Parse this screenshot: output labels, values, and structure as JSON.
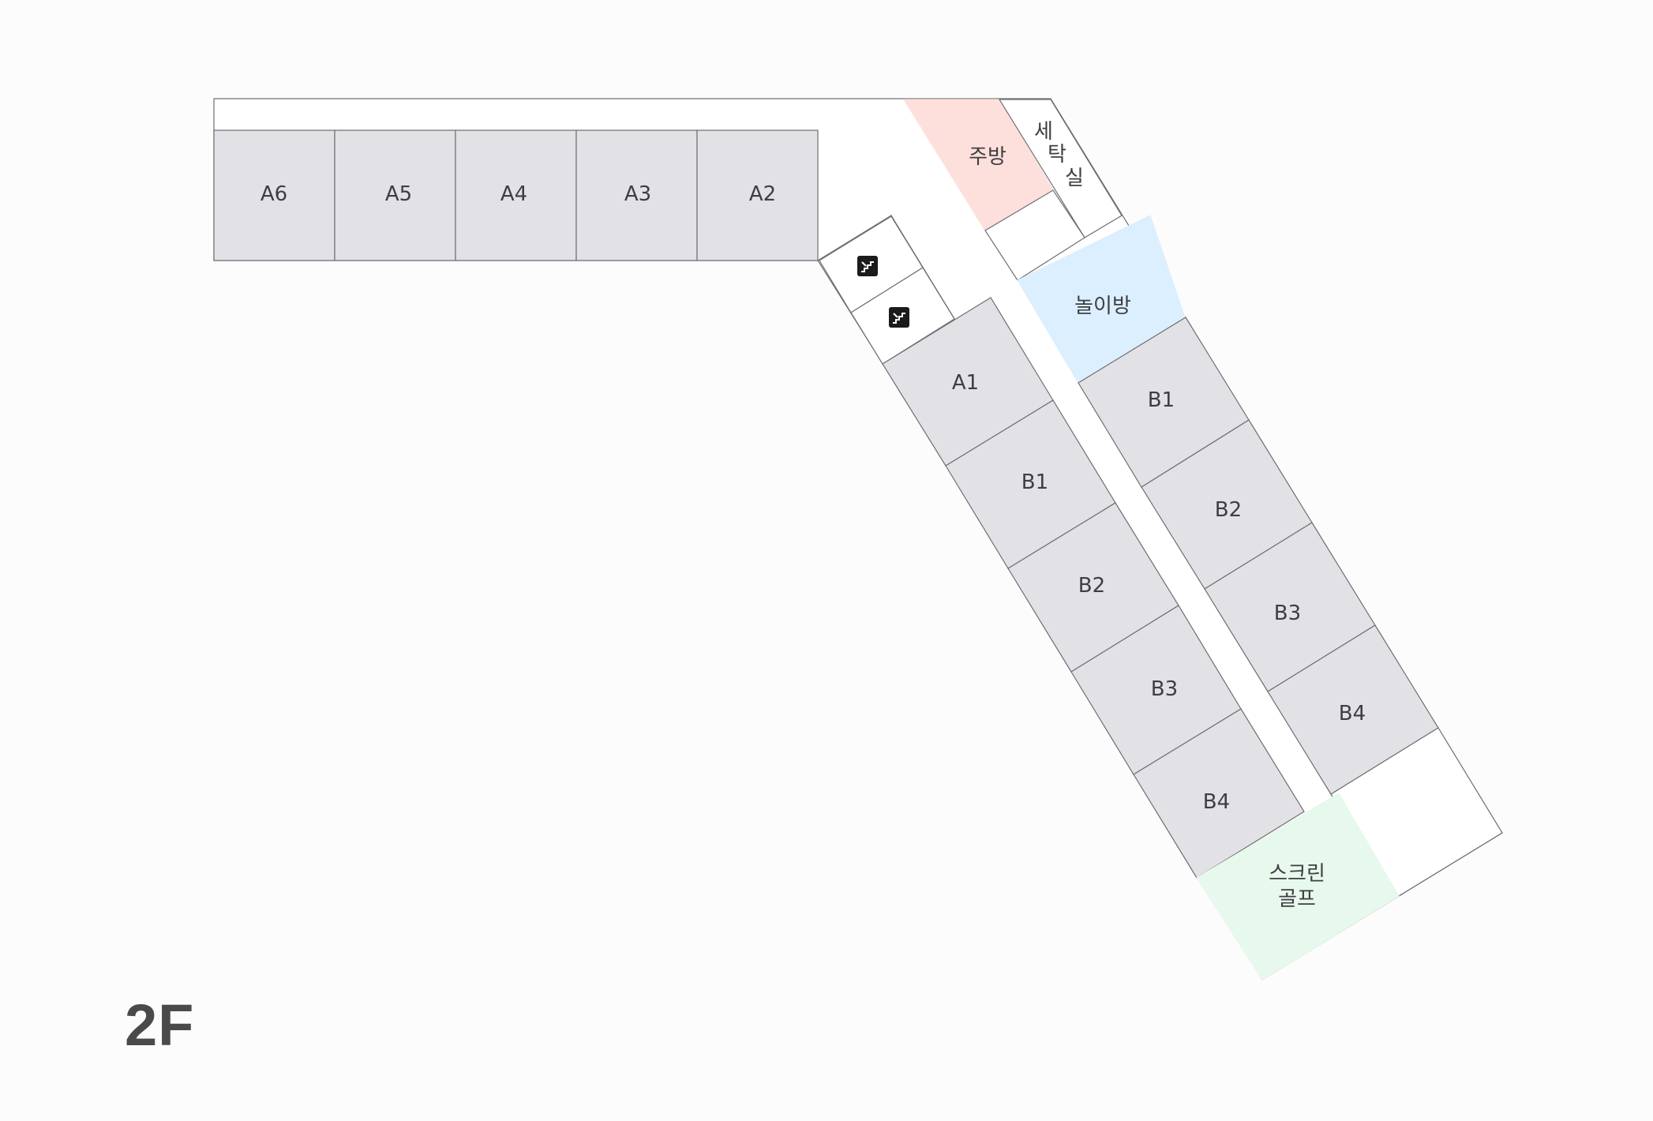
{
  "floor": {
    "label": "2F"
  },
  "rooms": {
    "a6": "A6",
    "a5": "A5",
    "a4": "A4",
    "a3": "A3",
    "a2": "A2",
    "kitchen": "주방",
    "laundry": [
      "세",
      "탁",
      "실"
    ],
    "playroom": "놀이방",
    "inner_a1": "A1",
    "inner_b1": "B1",
    "inner_b2": "B2",
    "inner_b3": "B3",
    "inner_b4": "B4",
    "outer_b1": "B1",
    "outer_b2": "B2",
    "outer_b3": "B3",
    "outer_b4": "B4",
    "screen_golf": [
      "스크린",
      "골프"
    ]
  },
  "icons": {
    "stairs_1": "stairs-icon",
    "stairs_2": "stairs-icon"
  },
  "colors": {
    "room_fill": "#e2e1e6",
    "kitchen_fill": "#fde0dc",
    "playroom_fill": "#dcefff",
    "golf_fill": "#e7f8ec",
    "outline": "#6f6f73"
  }
}
